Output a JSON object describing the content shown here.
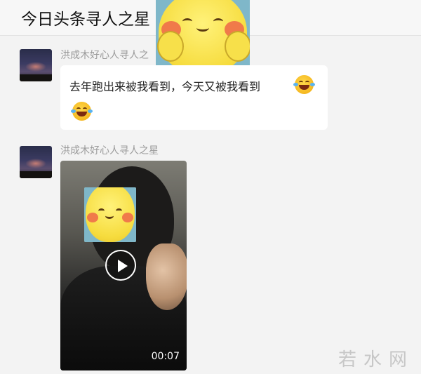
{
  "header": {
    "title": "今日头条寻人之星",
    "title_tail": "之"
  },
  "messages": [
    {
      "sender": "洪成木好心人寻人之",
      "text_line1": "去年跑出来被我看到，今天又被我看到",
      "emoji": "face-with-tears-of-joy-icon"
    },
    {
      "sender": "洪成木好心人寻人之星",
      "video_duration": "00:07"
    }
  ],
  "watermark": "若水网",
  "colors": {
    "background": "#f3f3f3",
    "bubble": "#ffffff",
    "sender_text": "#9a9a9a"
  }
}
